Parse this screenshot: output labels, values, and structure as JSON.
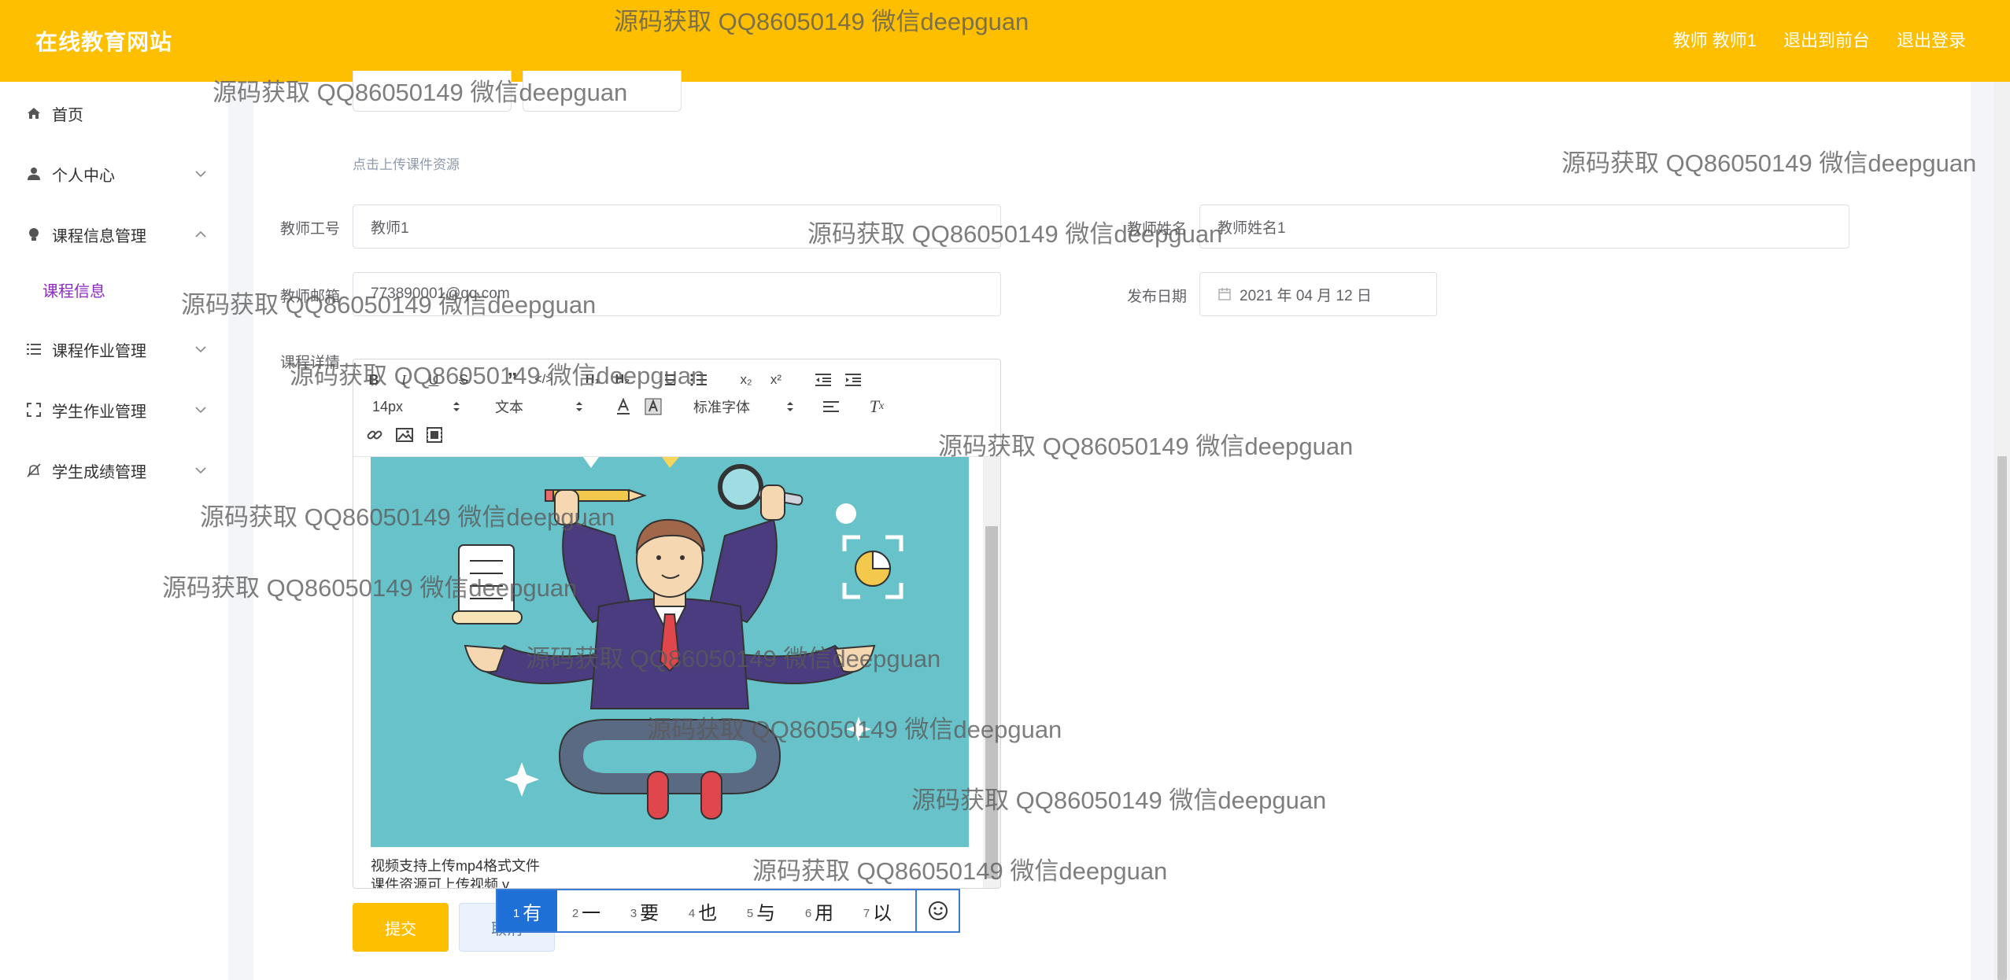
{
  "header": {
    "site_title": "在线教育网站",
    "user_label": "教师 教师1",
    "back_to_front": "退出到前台",
    "logout": "退出登录"
  },
  "sidebar": {
    "items": [
      {
        "label": "首页",
        "icon": "home-icon"
      },
      {
        "label": "个人中心",
        "icon": "user-icon"
      },
      {
        "label": "课程信息管理",
        "icon": "bulb-icon",
        "expanded": true
      },
      {
        "label": "课程作业管理",
        "icon": "list-icon"
      },
      {
        "label": "学生作业管理",
        "icon": "scan-icon"
      },
      {
        "label": "学生成绩管理",
        "icon": "bell-off-icon"
      }
    ],
    "sub_item": "课程信息",
    "active_color": "#8c2bc2"
  },
  "form": {
    "upload_hint": "点击上传课件资源",
    "teacher_no_label": "教师工号",
    "teacher_no_value": "教师1",
    "teacher_name_label": "教师姓名",
    "teacher_name_value": "教师姓名1",
    "teacher_email_label": "教师邮箱",
    "teacher_email_value": "773890001@qq.com",
    "publish_date_label": "发布日期",
    "publish_date_value": "2021 年 04 月 12 日",
    "detail_label": "课程详情"
  },
  "editor": {
    "font_size": "14px",
    "block_type": "文本",
    "font_family": "标准字体",
    "lines": [
      "视频支持上传mp4格式文件",
      "课件资源可上传视频 y"
    ]
  },
  "buttons": {
    "submit": "提交",
    "cancel": "取消"
  },
  "ime": {
    "candidates": [
      {
        "num": "1",
        "text": "有"
      },
      {
        "num": "2",
        "text": "一"
      },
      {
        "num": "3",
        "text": "要"
      },
      {
        "num": "4",
        "text": "也"
      },
      {
        "num": "5",
        "text": "与"
      },
      {
        "num": "6",
        "text": "用"
      },
      {
        "num": "7",
        "text": "以"
      }
    ]
  },
  "watermark": "源码获取 QQ86050149 微信deepguan",
  "colors": {
    "header": "#fdbf00",
    "illustration_bg": "#68c2c9",
    "ime_active": "#1e6fd6"
  }
}
